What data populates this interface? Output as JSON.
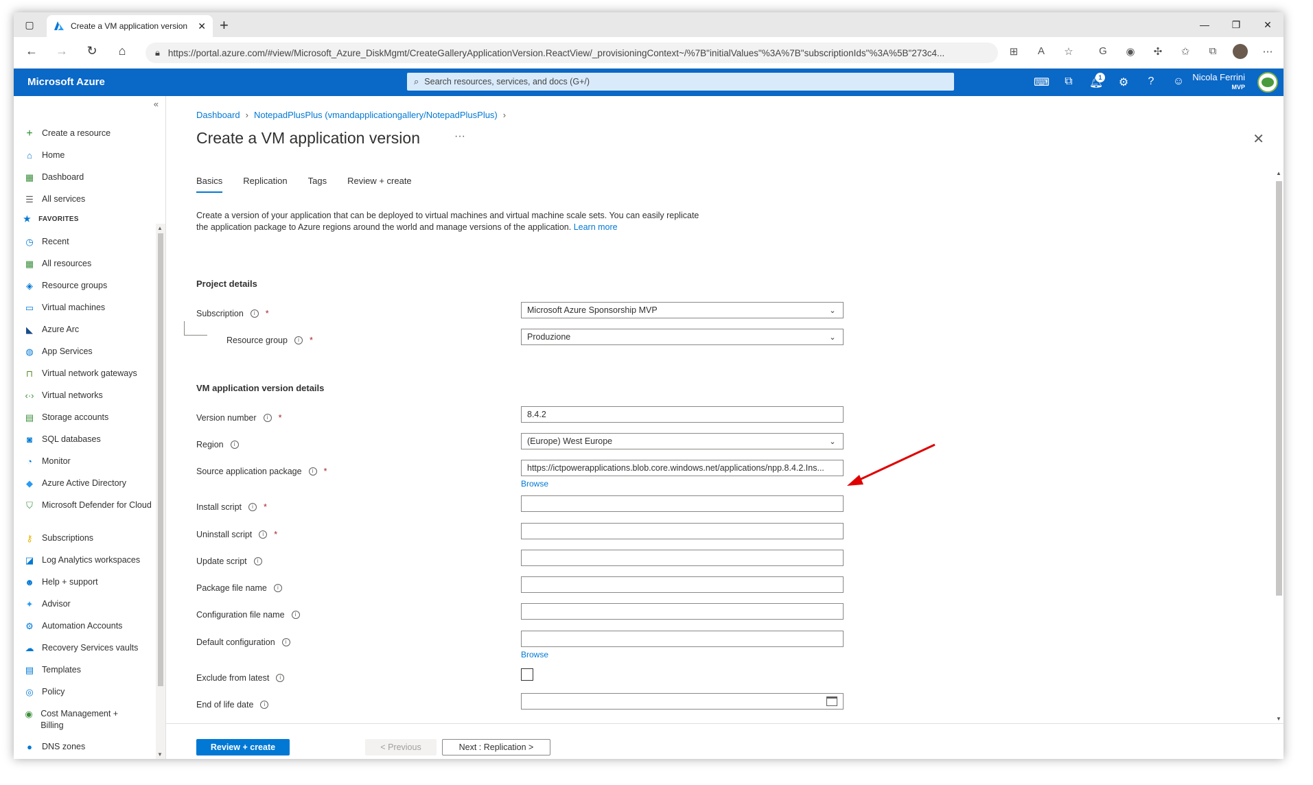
{
  "browser": {
    "tab_title": "Create a VM application version",
    "url": "https://portal.azure.com/#view/Microsoft_Azure_DiskMgmt/CreateGalleryApplicationVersion.ReactView/_provisioningContext~/%7B\"initialValues\"%3A%7B\"subscriptionIds\"%3A%5B\"273c4..."
  },
  "azure_header": {
    "brand": "Microsoft Azure",
    "search_placeholder": "Search resources, services, and docs (G+/)",
    "notification_count": "1",
    "user_name": "Nicola Ferrini",
    "user_badge": "MVP"
  },
  "sidebar": {
    "favorites_label": "FAVORITES",
    "items": [
      {
        "label": "Create a resource",
        "icon": "plus-icon"
      },
      {
        "label": "Home",
        "icon": "home-icon"
      },
      {
        "label": "Dashboard",
        "icon": "dashboard-icon"
      },
      {
        "label": "All services",
        "icon": "list-icon"
      },
      {
        "label": "Recent",
        "icon": "clock-icon"
      },
      {
        "label": "All resources",
        "icon": "grid-icon"
      },
      {
        "label": "Resource groups",
        "icon": "cube-icon"
      },
      {
        "label": "Virtual machines",
        "icon": "monitor-icon"
      },
      {
        "label": "Azure Arc",
        "icon": "arc-icon"
      },
      {
        "label": "App Services",
        "icon": "globe-icon"
      },
      {
        "label": "Virtual network gateways",
        "icon": "lock-icon"
      },
      {
        "label": "Virtual networks",
        "icon": "network-icon"
      },
      {
        "label": "Storage accounts",
        "icon": "storage-icon"
      },
      {
        "label": "SQL databases",
        "icon": "sql-icon"
      },
      {
        "label": "Monitor",
        "icon": "gauge-icon"
      },
      {
        "label": "Azure Active Directory",
        "icon": "diamond-icon"
      },
      {
        "label": "Microsoft Defender for Cloud",
        "icon": "shield-icon"
      },
      {
        "label": "Subscriptions",
        "icon": "key-icon"
      },
      {
        "label": "Log Analytics workspaces",
        "icon": "analytics-icon"
      },
      {
        "label": "Help + support",
        "icon": "person-icon"
      },
      {
        "label": "Advisor",
        "icon": "advisor-icon"
      },
      {
        "label": "Automation Accounts",
        "icon": "gear-icon"
      },
      {
        "label": "Recovery Services vaults",
        "icon": "cloud-icon"
      },
      {
        "label": "Templates",
        "icon": "document-icon"
      },
      {
        "label": "Policy",
        "icon": "policy-icon"
      },
      {
        "label": "Cost Management + Billing",
        "icon": "cost-icon"
      },
      {
        "label": "DNS zones",
        "icon": "dns-icon"
      }
    ]
  },
  "main": {
    "breadcrumb": [
      "Dashboard",
      "NotepadPlusPlus (vmandapplicationgallery/NotepadPlusPlus)"
    ],
    "title": "Create a VM application version",
    "tabs": [
      "Basics",
      "Replication",
      "Tags",
      "Review + create"
    ],
    "description": "Create a version of your application that can be deployed to virtual machines and virtual machine scale sets. You can easily replicate the application package to Azure regions around the world and manage versions of the application.",
    "learn_more": "Learn more",
    "project_details": "Project details",
    "subscription_label": "Subscription",
    "subscription_value": "Microsoft Azure Sponsorship MVP",
    "resource_group_label": "Resource group",
    "resource_group_value": "Produzione",
    "version_details": "VM application version details",
    "version_number_label": "Version number",
    "version_number_value": "8.4.2",
    "region_label": "Region",
    "region_value": "(Europe) West Europe",
    "source_package_label": "Source application package",
    "source_package_value": "https://ictpowerapplications.blob.core.windows.net/applications/npp.8.4.2.Ins...",
    "browse_label": "Browse",
    "install_script_label": "Install script",
    "uninstall_script_label": "Uninstall script",
    "update_script_label": "Update script",
    "package_file_name_label": "Package file name",
    "configuration_file_name_label": "Configuration file name",
    "default_configuration_label": "Default configuration",
    "exclude_from_latest_label": "Exclude from latest",
    "end_of_life_label": "End of life date",
    "required_mark": "*",
    "info_mark": "i"
  },
  "footer": {
    "review_create": "Review + create",
    "previous": "< Previous",
    "next": "Next : Replication >"
  },
  "colors": {
    "azure_blue": "#0a68c7",
    "link_blue": "#0078d4",
    "required_red": "#a4262c",
    "arrow_red": "#e00000"
  }
}
